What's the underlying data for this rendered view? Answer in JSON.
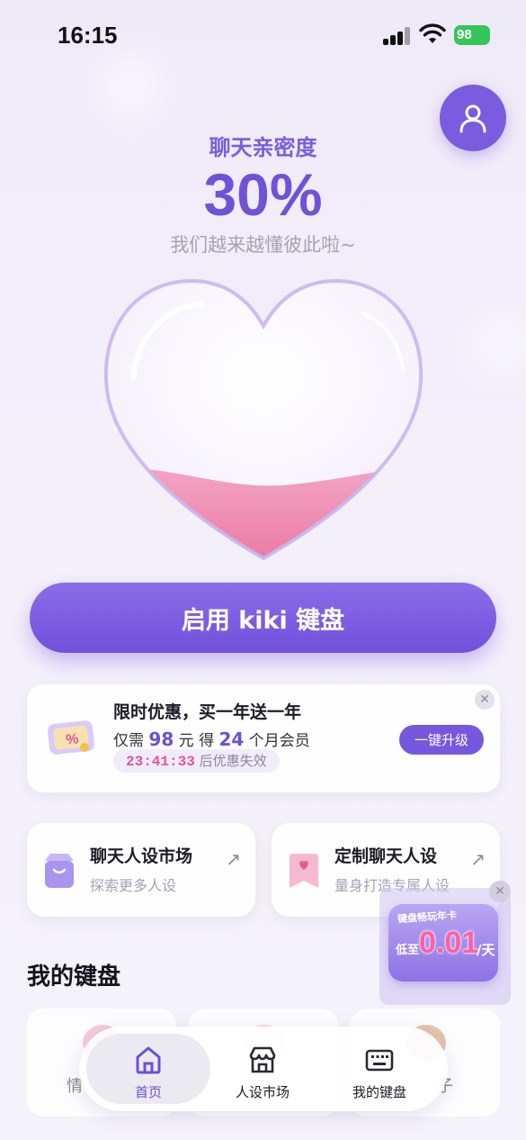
{
  "status_bar": {
    "time": "16:15",
    "battery": "98"
  },
  "intimacy": {
    "label": "聊天亲密度",
    "value": "30%",
    "subtitle": "我们越来越懂彼此啦~",
    "fill_level": 0.3
  },
  "enable_button": {
    "label": "启用 kiki 键盘"
  },
  "promo": {
    "title": "限时优惠，买一年送一年",
    "price_prefix": "仅需",
    "price_value": "98",
    "price_unit": "元",
    "gift_prefix": "得",
    "gift_value": "24",
    "gift_suffix": "个月会员",
    "countdown": "23:41:33",
    "countdown_suffix": "后优惠失效",
    "upgrade_label": "一键升级",
    "close_label": "✕"
  },
  "features": [
    {
      "title": "聊天人设市场",
      "subtitle": "探索更多人设",
      "arrow": "↗"
    },
    {
      "title": "定制聊天人设",
      "subtitle": "量身打造专属人设",
      "arrow": "↗"
    }
  ],
  "my_keyboards": {
    "title": "我的键盘",
    "items": [
      {
        "name": "情"
      },
      {
        "name": ""
      },
      {
        "name": "子"
      }
    ]
  },
  "float_ad": {
    "top_text": "键盘畅玩年卡",
    "prefix": "低至",
    "price": "0.01",
    "unit": "/天",
    "close_label": "✕"
  },
  "tab_bar": {
    "tabs": [
      {
        "label": "首页",
        "icon": "home-icon"
      },
      {
        "label": "人设市场",
        "icon": "store-icon"
      },
      {
        "label": "我的键盘",
        "icon": "keyboard-icon"
      }
    ]
  },
  "colors": {
    "accent": "#7a5ce0",
    "countdown": "#e0559a",
    "heart_fill": "#ee8fb8"
  }
}
